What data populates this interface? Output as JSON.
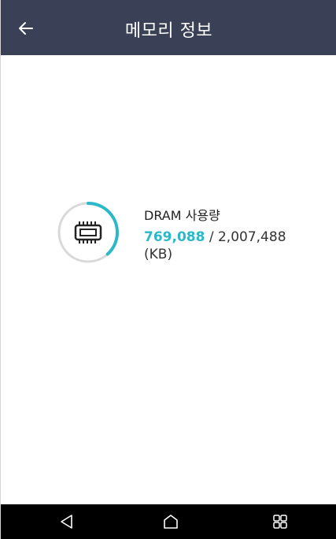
{
  "app_bar": {
    "title": "메모리 정보",
    "back_icon": "arrow-left-icon"
  },
  "memory": {
    "label": "DRAM 사용량",
    "used": "769,088",
    "separator": " / ",
    "total": "2,007,488",
    "unit": "(KB)",
    "used_fraction": 0.383,
    "accent_color": "#2bb8c8",
    "icon": "memory-chip-icon"
  },
  "nav_bar": {
    "back_icon": "triangle-back-icon",
    "home_icon": "home-icon",
    "recent_icon": "recent-apps-icon"
  },
  "colors": {
    "app_bar_bg": "#3a4156",
    "ring_track": "#d9d9d9"
  }
}
